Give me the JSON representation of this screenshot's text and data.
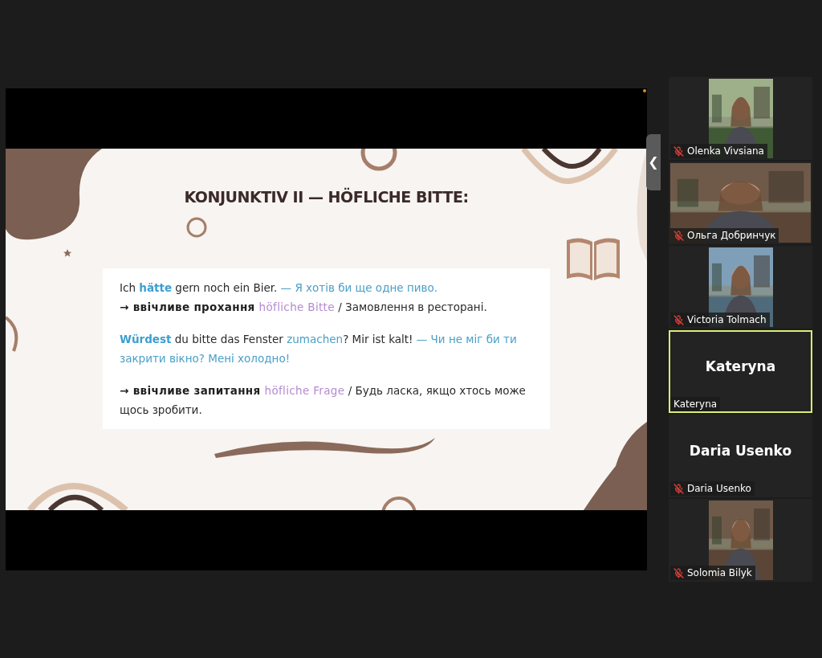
{
  "share": {
    "collapse_label": "❮",
    "slide": {
      "title": "KONJUNKTIV II — HÖFLICHE BITTE:",
      "paragraphs": [
        {
          "lines": [
            [
              {
                "kind": "plain",
                "text": "Ich "
              },
              {
                "kind": "blue",
                "text": "hätte"
              },
              {
                "kind": "plain",
                "text": " gern noch ein Bier. "
              },
              {
                "kind": "translation",
                "text": "— Я хотів би ще одне пиво."
              }
            ],
            [
              {
                "kind": "bold",
                "text": "→ ввічливе прохання "
              },
              {
                "kind": "purple",
                "text": "höfliche Bitte"
              },
              {
                "kind": "plain",
                "text": " / Замовлення в ресторані."
              }
            ]
          ]
        },
        {
          "lines": [
            [
              {
                "kind": "blue",
                "text": "Würdest"
              },
              {
                "kind": "plain",
                "text": " du bitte das Fenster "
              },
              {
                "kind": "translation",
                "text": "zumachen"
              },
              {
                "kind": "plain",
                "text": "? Mir ist kalt! "
              },
              {
                "kind": "translation",
                "text": "— Чи не міг би ти закрити вікно? Мені холодно!"
              }
            ]
          ]
        },
        {
          "lines": [
            [
              {
                "kind": "bold",
                "text": "→ ввічливе запитання "
              },
              {
                "kind": "purple",
                "text": "höfliche Frage"
              },
              {
                "kind": "plain",
                "text": " / Будь ласка, якщо хтось може щось зробити."
              }
            ]
          ]
        }
      ]
    }
  },
  "participants": [
    {
      "name": "Olenka Vivsiana",
      "kind": "video",
      "wide": false,
      "muted": true,
      "speaking": false
    },
    {
      "name": "Ольга Добринчук",
      "kind": "video",
      "wide": true,
      "muted": true,
      "speaking": false
    },
    {
      "name": "Victoria Tolmach",
      "kind": "video",
      "wide": false,
      "muted": true,
      "speaking": false
    },
    {
      "name": "Kateryna",
      "kind": "name",
      "display_name": "Kateryna",
      "muted": false,
      "speaking": true
    },
    {
      "name": "Daria Usenko",
      "kind": "name",
      "display_name": "Daria Usenko",
      "muted": true,
      "speaking": false
    },
    {
      "name": "Solomia Bilyk",
      "kind": "video",
      "wide": false,
      "muted": true,
      "speaking": false
    }
  ]
}
